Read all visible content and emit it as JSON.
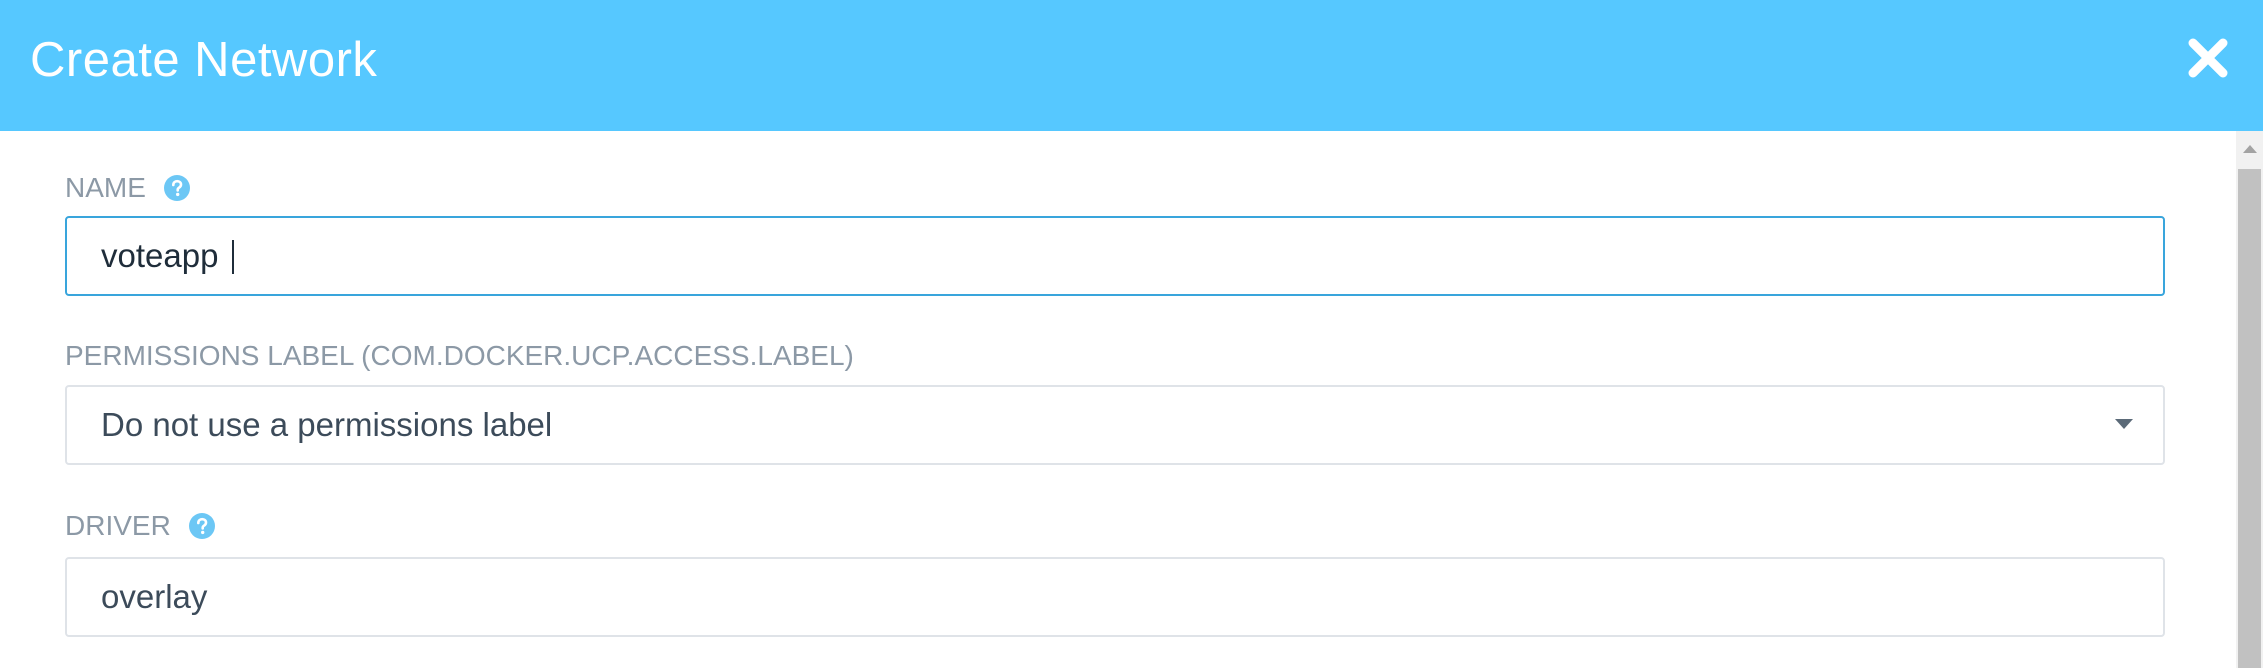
{
  "dialog": {
    "title": "Create Network",
    "close_icon": "close-icon"
  },
  "form": {
    "name": {
      "label": "NAME",
      "value": "voteapp",
      "help_icon": "question-circle-icon"
    },
    "permissions": {
      "label": "PERMISSIONS LABEL (COM.DOCKER.UCP.ACCESS.LABEL)",
      "selected": "Do not use a permissions label"
    },
    "driver": {
      "label": "DRIVER",
      "value": "overlay",
      "help_icon": "question-circle-icon"
    }
  },
  "colors": {
    "header_bg": "#56c8ff",
    "focus_border": "#39a5dc",
    "help_icon": "#6cc7f5"
  }
}
